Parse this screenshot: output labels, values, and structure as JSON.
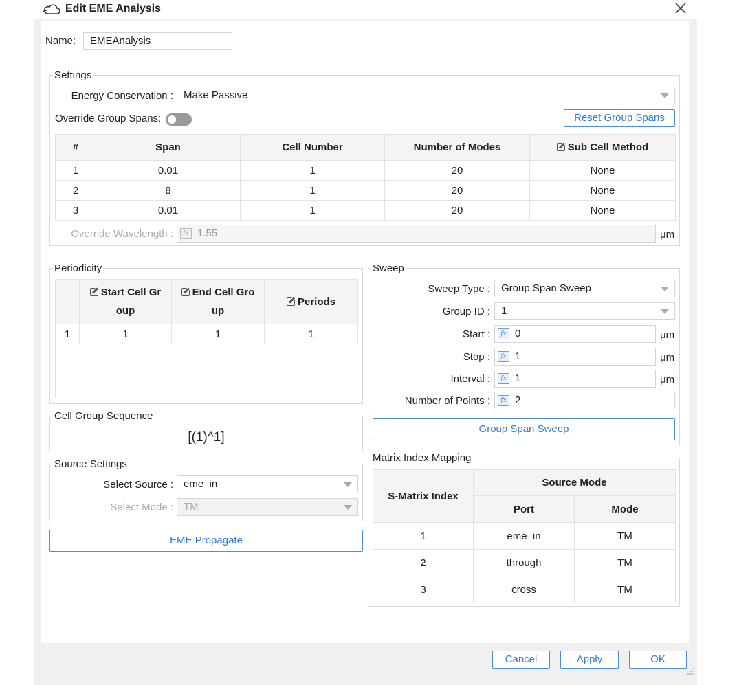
{
  "window": {
    "title": "Edit EME Analysis"
  },
  "name": {
    "label": "Name:",
    "value": "EMEAnalysis"
  },
  "settings": {
    "title": "Settings",
    "energy_conservation": {
      "label": "Energy Conservation :",
      "value": "Make Passive"
    },
    "override_group_spans": {
      "label": "Override Group Spans:",
      "on": false
    },
    "reset_button": "Reset Group Spans",
    "table": {
      "headers": [
        "#",
        "Span",
        "Cell Number",
        "Number of Modes",
        "Sub Cell Method"
      ],
      "rows": [
        [
          "1",
          "0.01",
          "1",
          "20",
          "None"
        ],
        [
          "2",
          "8",
          "1",
          "20",
          "None"
        ],
        [
          "3",
          "0.01",
          "1",
          "20",
          "None"
        ]
      ]
    },
    "override_wavelength": {
      "label": "Override Wavelength :",
      "value": "1.55",
      "unit": "μm"
    }
  },
  "periodicity": {
    "title": "Periodicity",
    "headers": {
      "start_line1": "Start Cell Gr",
      "start_line2": "oup",
      "end_line1": "End Cell Gro",
      "end_line2": "up",
      "periods": "Periods"
    },
    "rows": [
      [
        "1",
        "1",
        "1",
        "1"
      ]
    ]
  },
  "cell_group_sequence": {
    "title": "Cell Group Sequence",
    "value": "[(1)^1]"
  },
  "source_settings": {
    "title": "Source Settings",
    "select_source": {
      "label": "Select Source :",
      "value": "eme_in"
    },
    "select_mode": {
      "label": "Select Mode :",
      "value": "TM"
    }
  },
  "eme_propagate_button": "EME Propagate",
  "sweep": {
    "title": "Sweep",
    "sweep_type": {
      "label": "Sweep Type :",
      "value": "Group Span Sweep"
    },
    "group_id": {
      "label": "Group ID :",
      "value": "1"
    },
    "start": {
      "label": "Start :",
      "value": "0",
      "unit": "μm"
    },
    "stop": {
      "label": "Stop :",
      "value": "1",
      "unit": "μm"
    },
    "interval": {
      "label": "Interval :",
      "value": "1",
      "unit": "μm"
    },
    "num_points": {
      "label": "Number of Points :",
      "value": "2"
    },
    "button": "Group Span Sweep"
  },
  "matrix_index_mapping": {
    "title": "Matrix Index Mapping",
    "headers": {
      "s_matrix_index": "S-Matrix Index",
      "source_mode": "Source Mode",
      "port": "Port",
      "mode": "Mode"
    },
    "rows": [
      [
        "1",
        "eme_in",
        "TM"
      ],
      [
        "2",
        "through",
        "TM"
      ],
      [
        "3",
        "cross",
        "TM"
      ]
    ]
  },
  "footer": {
    "cancel": "Cancel",
    "apply": "Apply",
    "ok": "OK"
  },
  "icons": {
    "title": "cloud-icon",
    "fx": "fx-icon",
    "edit": "edit-icon",
    "close": "close-icon"
  },
  "colors": {
    "accent": "#2f7ad6",
    "toggle_off": "#9a9a9a"
  }
}
